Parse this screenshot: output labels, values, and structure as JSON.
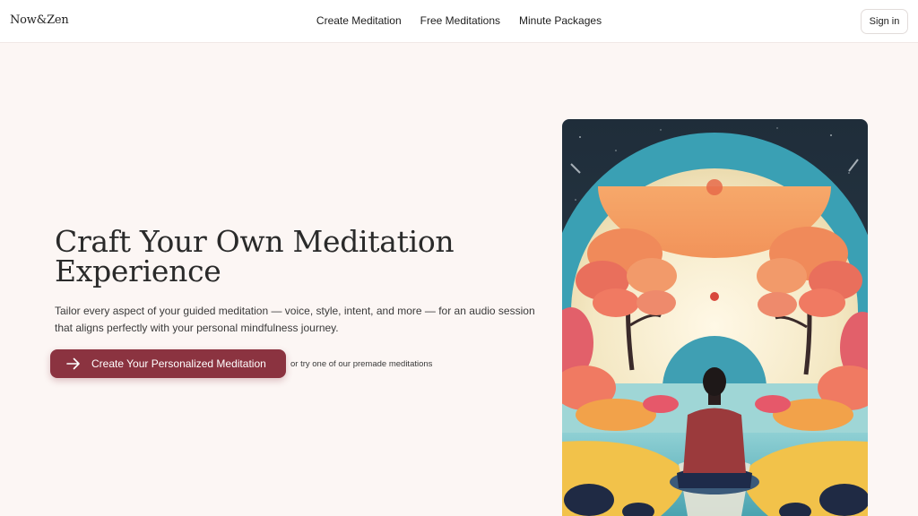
{
  "header": {
    "logo": "Now&Zen",
    "nav": [
      "Create Meditation",
      "Free Meditations",
      "Minute Packages"
    ],
    "sign_in": "Sign in"
  },
  "hero": {
    "title_line1": "Craft Your Own Meditation",
    "title_line2": "Experience",
    "subtitle_line1": "Tailor every aspect of your guided meditation — voice, style, intent, and more — for an audio session",
    "subtitle_line2": "that aligns perfectly with your personal mindfulness journey.",
    "cta_label": "Create Your Personalized Meditation",
    "alt_link": "or try one of our premade meditations"
  },
  "colors": {
    "background": "#fcf6f4",
    "accent": "#8b3340"
  },
  "icons": {
    "cta_icon": "arrow-right-icon"
  }
}
